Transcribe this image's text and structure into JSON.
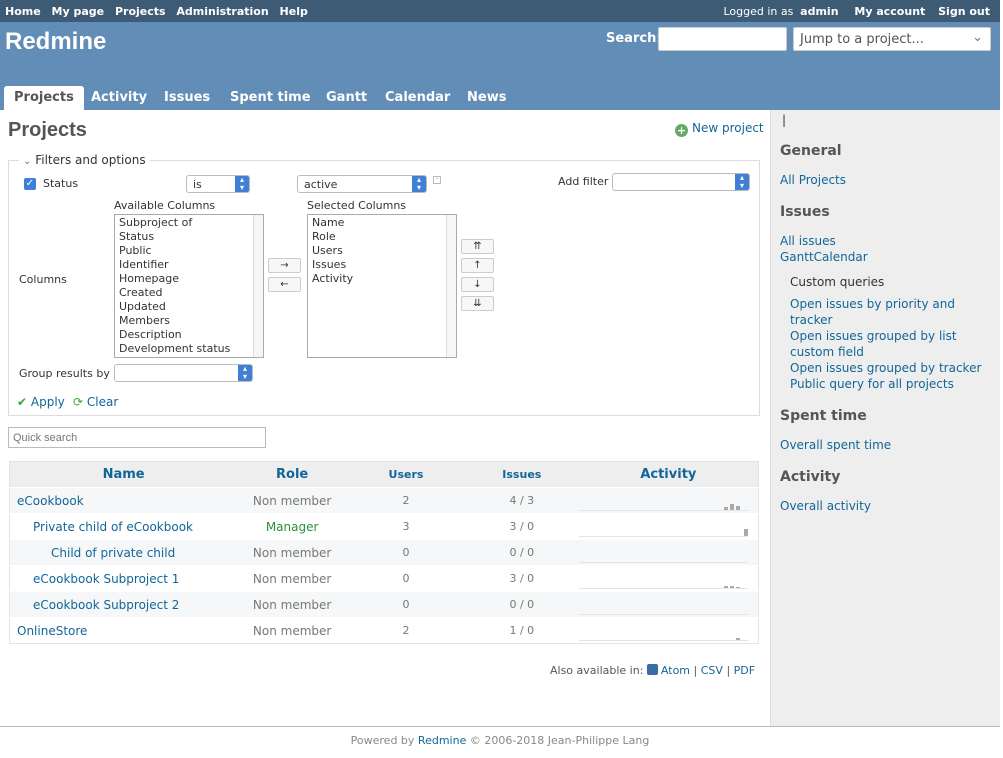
{
  "top_menu": {
    "left": [
      "Home",
      "My page",
      "Projects",
      "Administration",
      "Help"
    ],
    "logged_in_prefix": "Logged in as",
    "user": "admin",
    "my_account": "My account",
    "sign_out": "Sign out"
  },
  "header": {
    "title": "Redmine",
    "search_label": "Search:",
    "jump_placeholder": "Jump to a project..."
  },
  "main_menu": [
    "Projects",
    "Activity",
    "Issues",
    "Spent time",
    "Gantt",
    "Calendar",
    "News"
  ],
  "content": {
    "title": "Projects",
    "new_project": "New project",
    "filters": {
      "legend": "Filters and options",
      "status_label": "Status",
      "operator": "is",
      "value": "active",
      "add_filter": "Add filter",
      "columns_label": "Columns",
      "available_label": "Available Columns",
      "selected_label": "Selected Columns",
      "available": [
        "Subproject of",
        "Status",
        "Public",
        "Identifier",
        "Homepage",
        "Created",
        "Updated",
        "Members",
        "Description",
        "Development status"
      ],
      "selected": [
        "Name",
        "Role",
        "Users",
        "Issues",
        "Activity"
      ],
      "move_right": "→",
      "move_left": "←",
      "move_top": "⇈",
      "move_up": "↑",
      "move_down": "↓",
      "move_bottom": "⇊",
      "group_by_label": "Group results by",
      "apply": "Apply",
      "clear": "Clear"
    },
    "quick_search_placeholder": "Quick search",
    "table": {
      "headers": [
        "Name",
        "Role",
        "Users",
        "Issues",
        "Activity"
      ],
      "rows": [
        {
          "name": "eCookbook",
          "role": "Non member",
          "users": "2",
          "issues": "4 / 3"
        },
        {
          "name": "Private child of eCookbook",
          "role": "Manager",
          "users": "3",
          "issues": "3 / 0"
        },
        {
          "name": "Child of private child",
          "role": "Non member",
          "users": "0",
          "issues": "0 / 0"
        },
        {
          "name": "eCookbook Subproject 1",
          "role": "Non member",
          "users": "0",
          "issues": "3 / 0"
        },
        {
          "name": "eCookbook Subproject 2",
          "role": "Non member",
          "users": "0",
          "issues": "0 / 0"
        },
        {
          "name": "OnlineStore",
          "role": "Non member",
          "users": "2",
          "issues": "1 / 0"
        }
      ]
    },
    "also_available": "Also available in:",
    "formats": [
      "Atom",
      "CSV",
      "PDF"
    ]
  },
  "sidebar": {
    "caret": "|",
    "general": "General",
    "all_projects": "All Projects",
    "issues": "Issues",
    "all_issues": "All issues",
    "gantt_calendar": "GanttCalendar",
    "custom_queries": "Custom queries",
    "queries": [
      "Open issues by priority and tracker",
      "Open issues grouped by list custom field",
      "Open issues grouped by tracker",
      "Public query for all projects"
    ],
    "spent_time": "Spent time",
    "overall_spent_time": "Overall spent time",
    "activity": "Activity",
    "overall_activity": "Overall activity"
  },
  "footer": {
    "powered_by": "Powered by",
    "redmine": "Redmine",
    "copyright": "© 2006-2018 Jean-Philippe Lang"
  }
}
